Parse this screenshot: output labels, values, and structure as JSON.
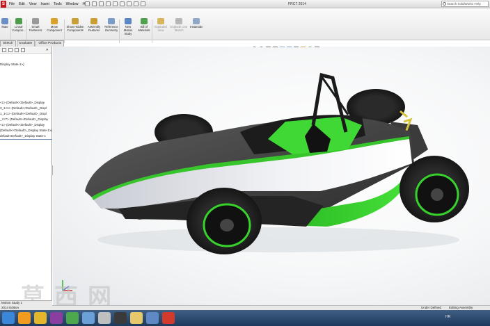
{
  "menubar": {
    "logo": "S",
    "items": [
      "File",
      "Edit",
      "View",
      "Insert",
      "Tools",
      "Window",
      "Help"
    ],
    "document_title": "FRCT 2014",
    "search_placeholder": "Search SolidWorks Help"
  },
  "ribbon": {
    "buttons": [
      {
        "label": "Mate",
        "icon": "mate-icon",
        "color": "#6b8fc5",
        "enabled": true
      },
      {
        "label": "Linear Compon...",
        "icon": "linear-pattern-icon",
        "color": "#4f9c4f",
        "enabled": true
      },
      {
        "label": "Smart Fasteners",
        "icon": "fastener-icon",
        "color": "#9a9a9a",
        "enabled": true
      },
      {
        "label": "Move Component",
        "icon": "move-component-icon",
        "color": "#d9a22b",
        "enabled": true
      },
      {
        "label": "Show Hidden Components",
        "icon": "show-hidden-icon",
        "color": "#c9a036",
        "enabled": true
      },
      {
        "label": "Assembly Features",
        "icon": "assembly-features-icon",
        "color": "#c9a036",
        "enabled": true
      },
      {
        "label": "Reference Geometry",
        "icon": "reference-geometry-icon",
        "color": "#7c9cc7",
        "enabled": true
      },
      {
        "label": "New Motion Study",
        "icon": "motion-study-icon",
        "color": "#5a84c2",
        "enabled": true
      },
      {
        "label": "Bill of Materials",
        "icon": "bill-of-materials-icon",
        "color": "#4fa04f",
        "enabled": true
      },
      {
        "label": "Exploded View",
        "icon": "exploded-view-icon",
        "color": "#d7b55c",
        "enabled": false
      },
      {
        "label": "Explode Line Sketch",
        "icon": "explode-line-icon",
        "color": "#b8b8b8",
        "enabled": false
      },
      {
        "label": "Instant3D",
        "icon": "instant3d-icon",
        "color": "#8fa8c8",
        "enabled": true
      }
    ]
  },
  "tabs": [
    "Sketch",
    "Evaluate",
    "Office Products"
  ],
  "tree": {
    "lines": [
      "Display State-1>)",
      "<1> (Default<<Default>_Display",
      "3_1<1> (Default<<Default>_Displ",
      "1_1<1> (Default<<Default>_Displ",
      "_7<7> (Default<<Default>_Display",
      "<1> (Default<<Default>_Display",
      "(Default<<Default>_Display State-1>)",
      "default<Default>_Display State-1"
    ]
  },
  "bottom_tabs": [
    "Motion Study 1",
    "2014 Edition"
  ],
  "status": {
    "defined": "Under Defined",
    "editing": "Editing Assembly"
  },
  "taskbar": {
    "items": [
      {
        "icon": "start-icon",
        "color": "#3a86d8"
      },
      {
        "icon": "media-player-icon",
        "color": "#f29b20"
      },
      {
        "icon": "chrome-icon",
        "color": "#e3b62b"
      },
      {
        "icon": "rar-icon",
        "color": "#8a3fa0"
      },
      {
        "icon": "torrent-icon",
        "color": "#4da84d"
      },
      {
        "icon": "browser-icon",
        "color": "#6a9fd8"
      },
      {
        "icon": "steering-icon",
        "color": "#bfbfbf"
      },
      {
        "icon": "ai-icon",
        "color": "#3a3a3a"
      },
      {
        "icon": "folder-icon",
        "color": "#e8c86a"
      },
      {
        "icon": "paint-icon",
        "color": "#5e89c4"
      },
      {
        "icon": "solidworks-icon",
        "color": "#d23b2b"
      }
    ],
    "tray_language": "HR"
  },
  "watermark": "莫西网"
}
